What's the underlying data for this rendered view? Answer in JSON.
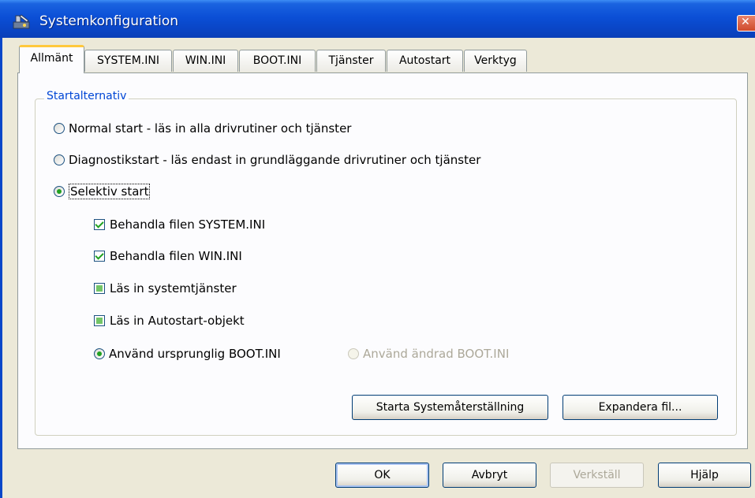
{
  "window": {
    "title": "Systemkonfiguration"
  },
  "tabs": [
    {
      "label": "Allmänt",
      "active": true
    },
    {
      "label": "SYSTEM.INI",
      "active": false
    },
    {
      "label": "WIN.INI",
      "active": false
    },
    {
      "label": "BOOT.INI",
      "active": false
    },
    {
      "label": "Tjänster",
      "active": false
    },
    {
      "label": "Autostart",
      "active": false
    },
    {
      "label": "Verktyg",
      "active": false
    }
  ],
  "startup": {
    "group_title": "Startalternativ",
    "normal": {
      "label": "Normal start - läs in alla drivrutiner och tjänster",
      "checked": false
    },
    "diagnostic": {
      "label": "Diagnostikstart - läs endast in grundläggande drivrutiner och tjänster",
      "checked": false
    },
    "selective": {
      "label": "Selektiv start",
      "checked": true
    },
    "process_system_ini": {
      "label": "Behandla filen SYSTEM.INI",
      "state": "checked"
    },
    "process_win_ini": {
      "label": "Behandla filen WIN.INI",
      "state": "checked"
    },
    "load_services": {
      "label": "Läs in systemtjänster",
      "state": "mixed"
    },
    "load_startup": {
      "label": "Läs in Autostart-objekt",
      "state": "mixed"
    },
    "use_original_boot": {
      "label": "Använd ursprunglig BOOT.INI",
      "checked": true
    },
    "use_modified_boot": {
      "label": "Använd ändrad BOOT.INI",
      "checked": false,
      "disabled": true
    }
  },
  "panel_buttons": {
    "system_restore": "Starta Systemåterställning",
    "expand_file": "Expandera fil..."
  },
  "dialog_buttons": {
    "ok": "OK",
    "cancel": "Avbryt",
    "apply": "Verkställ",
    "help": "Hjälp"
  },
  "colors": {
    "titlebar": "#0a47c9",
    "group_title": "#0046d5",
    "check_green": "#21a121",
    "active_tab_highlight": "#ffc83c"
  }
}
